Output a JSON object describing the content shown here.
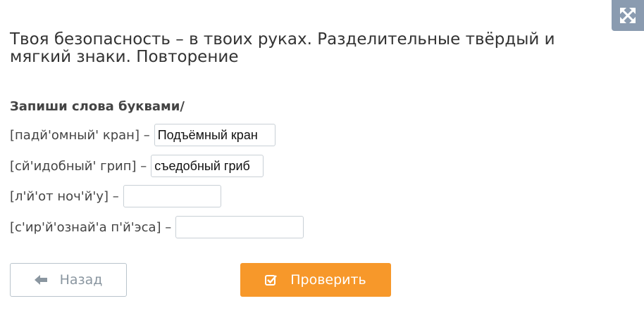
{
  "header": {
    "title": "Твоя безопасность – в твоих руках. Разделительные твёрдый и мягкий знаки. Повторение",
    "expand_icon": "expand-arrows-icon"
  },
  "task": {
    "instruction": "Запиши слова буквами/",
    "items": [
      {
        "transcription": "[падй'омный' кран] –",
        "answer": "Подъёмный кран"
      },
      {
        "transcription": "[сй'идобный' грип] –",
        "answer": "съедобный гриб"
      },
      {
        "transcription": "[л'й'от ноч'й'у] –",
        "answer": ""
      },
      {
        "transcription": "[с'ир'й'ознай'а п'й'эса] –",
        "answer": ""
      }
    ]
  },
  "buttons": {
    "back_label": "Назад",
    "back_icon": "arrow-left-icon",
    "check_label": "Проверить",
    "check_icon": "checkbox-check-icon",
    "check_color": "#f7982a"
  }
}
